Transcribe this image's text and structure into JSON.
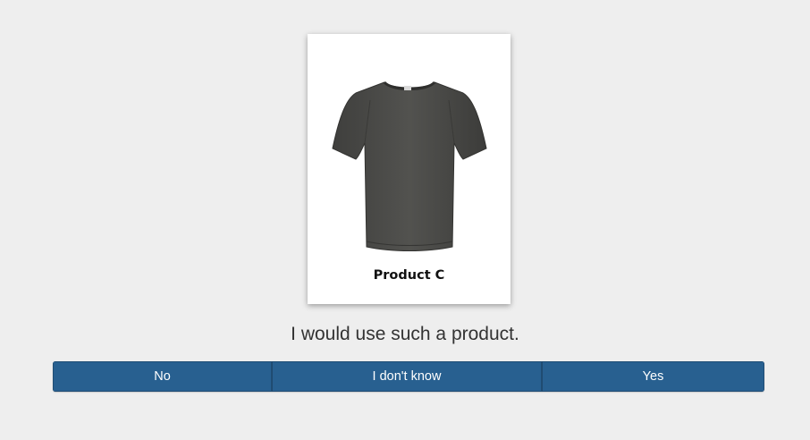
{
  "product": {
    "label": "Product C",
    "image_icon": "tshirt-image",
    "shirt_color": "#4a4a48"
  },
  "question": {
    "text": "I would use such a product."
  },
  "answers": {
    "no_label": "No",
    "dont_know_label": "I don't know",
    "yes_label": "Yes"
  },
  "colors": {
    "button_bg": "#286090",
    "page_bg": "#eeeeee"
  }
}
